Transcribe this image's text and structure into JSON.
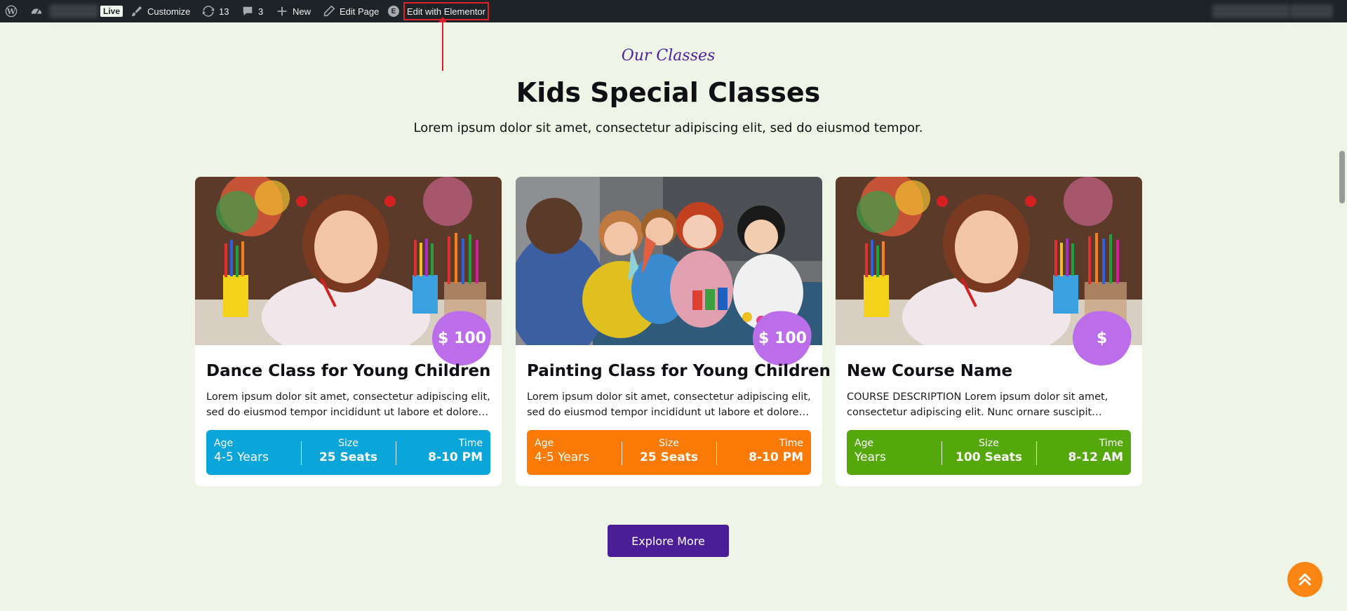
{
  "adminbar": {
    "live_label": "Live",
    "customize_label": "Customize",
    "updates_count": "13",
    "comments_count": "3",
    "new_label": "New",
    "edit_page_label": "Edit Page",
    "elementor_label": "Edit with Elementor",
    "elementor_badge": "E"
  },
  "section": {
    "eyebrow": "Our Classes",
    "title": "Kids Special Classes",
    "subtitle": "Lorem ipsum dolor sit amet, consectetur adipiscing elit, sed do eiusmod tempor."
  },
  "labels": {
    "age": "Age",
    "size": "Size",
    "time": "Time"
  },
  "cards": [
    {
      "price": "$ 100",
      "title": "Dance Class for Young Children",
      "desc": "Lorem ipsum dolor sit amet, consectetur adipiscing elit, sed do eiusmod tempor incididunt ut labore et dolore…",
      "age": "4-5 Years",
      "size": "25 Seats",
      "time": "8-10 PM",
      "color": "#0aa6d9",
      "image": "girl-drawing-photo"
    },
    {
      "price": "$ 100",
      "title": "Painting Class for Young Children",
      "desc": "Lorem ipsum dolor sit amet, consectetur adipiscing elit, sed do eiusmod tempor incididunt ut labore et dolore…",
      "age": "4-5 Years",
      "size": "25 Seats",
      "time": "8-10 PM",
      "color": "#fb7a06",
      "image": "children-classroom-photo"
    },
    {
      "price": "$",
      "title": "New Course Name",
      "desc": "COURSE DESCRIPTION   Lorem ipsum dolor sit amet, consectetur adipiscing elit. Nunc ornare suscipit…",
      "age": " Years",
      "size": "100 Seats",
      "time": "8-12 AM",
      "color": "#55a80c",
      "image": "girl-drawing-photo"
    }
  ],
  "explore_label": "Explore More",
  "colors": {
    "background": "#eef5e6",
    "accent": "#4b1d96",
    "price_blob": "#bb6dea",
    "to_top": "#fb8614"
  }
}
